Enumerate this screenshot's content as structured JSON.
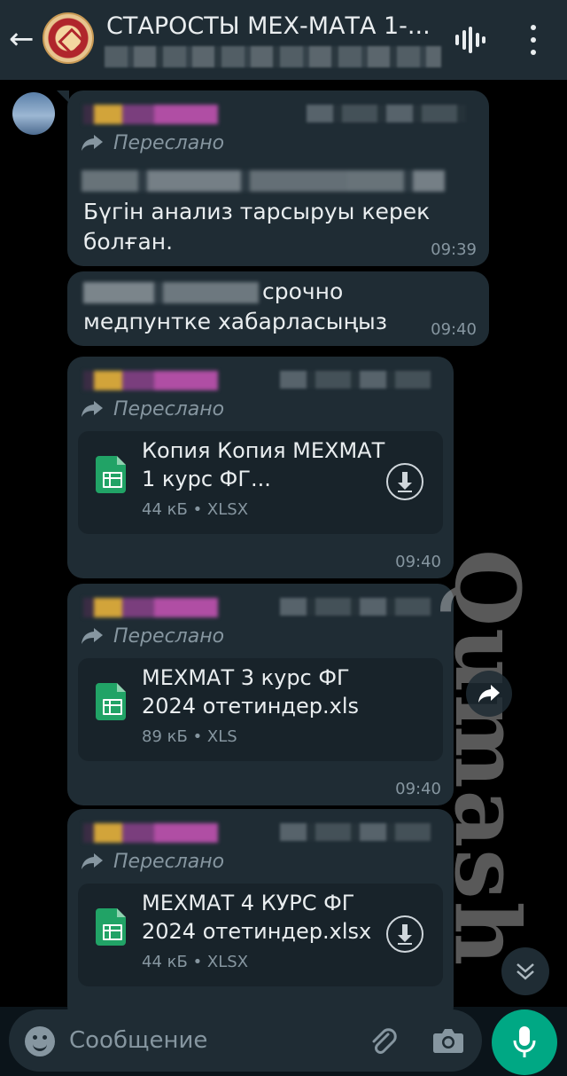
{
  "header": {
    "title": "СТАРОСТЫ МЕХ-МАТА 1-..."
  },
  "icons": {
    "back": "←",
    "menu": "more-vert-icon",
    "voice": "voice-call-icon"
  },
  "messages": [
    {
      "forwarded_label": "Переслано",
      "text": "Бүгін анализ тарсыруы керек болған.",
      "time": "09:39"
    },
    {
      "text": "срочно медпунтке хабарласыңыз",
      "time": "09:40"
    },
    {
      "forwarded_label": "Переслано",
      "file_name": "Копия Копия МЕХМАТ 1 курс ФГ...",
      "file_meta": "44 кБ • XLSX",
      "time": "09:40"
    },
    {
      "forwarded_label": "Переслано",
      "file_name": "МЕХМАТ 3 курс ФГ 2024 отетиндер.xls",
      "file_meta": "89 кБ • XLS",
      "time": "09:40"
    },
    {
      "forwarded_label": "Переслано",
      "file_name": "МЕХМАТ 4 КУРС ФГ 2024 отетиндер.xlsx",
      "file_meta": "44 кБ • XLSX"
    }
  ],
  "watermark": "Qumash",
  "composer": {
    "placeholder": "Сообщение"
  },
  "colors": {
    "accent": "#00a884",
    "bubble": "#1f2c34",
    "header": "#1f2c34"
  }
}
